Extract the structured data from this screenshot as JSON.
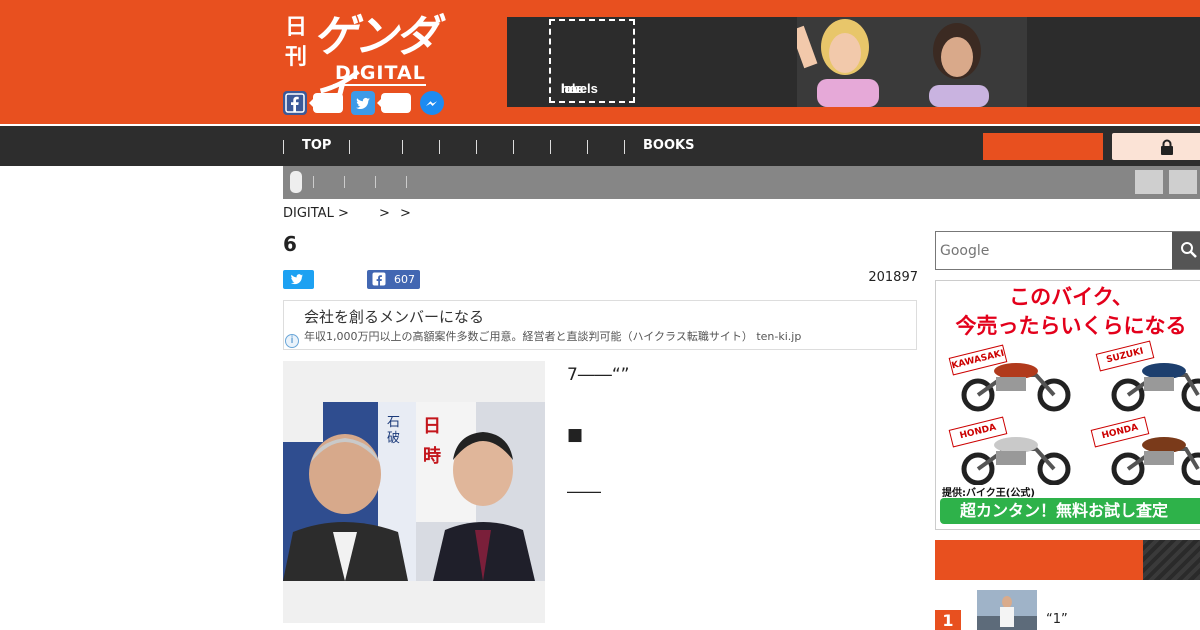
{
  "brand": {
    "kanji": "日刊",
    "name": "ゲンダイ",
    "sub": "DIGITAL",
    "color": "#e8501f"
  },
  "header_ad": {
    "line1": "love",
    "line2": "has",
    "line3": "no",
    "line4": "labels"
  },
  "nav": {
    "top_label": "TOP",
    "books_label": "BOOKS"
  },
  "breadcrumb": {
    "root": "DIGITAL >",
    "sep1": ">",
    "sep2": ">"
  },
  "article": {
    "title": "6",
    "fb_count": "607",
    "date": "201897",
    "line1": "7――“”",
    "line2": "■",
    "line3": "――"
  },
  "text_ad": {
    "headline": "会社を創るメンバーになる",
    "sub": "年収1,000万円以上の高額案件多数ご用意。経営者と直談判可能（ハイクラス転職サイト） ten-ki.jp",
    "info": "i"
  },
  "search": {
    "placeholder": "Google"
  },
  "bike_ad": {
    "headline1": "このバイク、",
    "headline2": "今売ったらいくらになる",
    "tag1": "KAWASAKI",
    "tag2": "SUZUKI",
    "tag3": "HONDA",
    "tag4": "HONDA",
    "credit": "提供:バイク王(公式)",
    "cta": "超カンタン！無料お試し査定"
  },
  "ranking": {
    "num1": "1",
    "title1": "“1”"
  }
}
